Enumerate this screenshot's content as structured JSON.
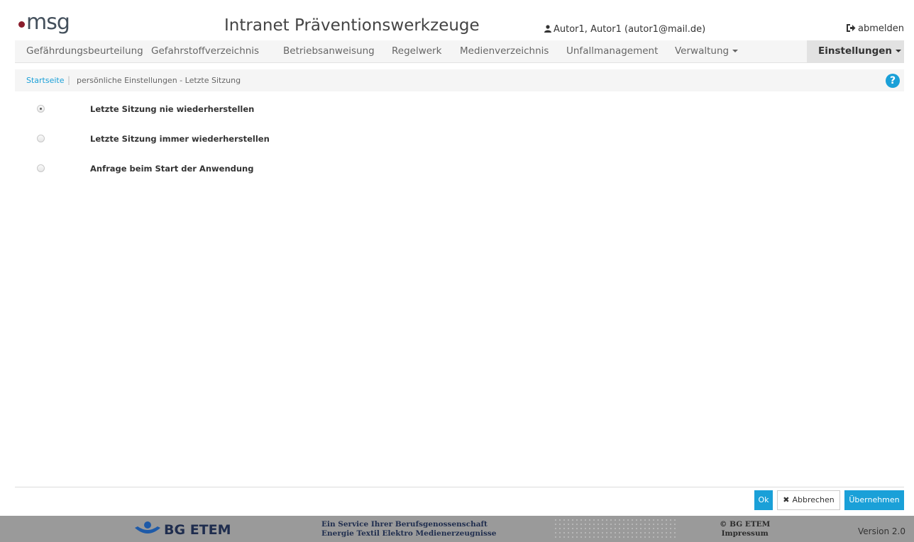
{
  "header": {
    "logo_text": "msg",
    "app_title": "Intranet Präventionswerkzeuge",
    "user": "Autor1, Autor1 (autor1@mail.de)",
    "logout_label": "abmelden"
  },
  "nav": {
    "items": [
      {
        "label": "Gefährdungsbeurteilung"
      },
      {
        "label": "Gefahrstoffverzeichnis"
      },
      {
        "label": "Betriebsanweisung"
      },
      {
        "label": "Regelwerk"
      },
      {
        "label": "Medienverzeichnis"
      },
      {
        "label": "Unfallmanagement"
      },
      {
        "label": "Verwaltung"
      }
    ],
    "active": "Einstellungen"
  },
  "breadcrumb": {
    "home": "Startseite",
    "separator": "|",
    "current": "persönliche Einstellungen - Letzte Sitzung"
  },
  "help_icon": "?",
  "options": [
    {
      "label": "Letzte Sitzung nie wiederherstellen",
      "checked": true
    },
    {
      "label": "Letzte Sitzung immer wiederherstellen",
      "checked": false
    },
    {
      "label": "Anfrage beim Start der Anwendung",
      "checked": false
    }
  ],
  "buttons": {
    "ok": "Ok",
    "cancel": "Abbrechen",
    "apply": "Übernehmen"
  },
  "footer": {
    "brand": "BG ETEM",
    "service_line1": "Ein Service Ihrer Berufsgenossenschaft",
    "service_line2": "Energie Textil Elektro Medienerzeugnisse",
    "copyright": "© BG ETEM",
    "impressum": "Impressum",
    "version": "Version 2.0"
  },
  "colors": {
    "accent": "#1aa0d8",
    "logo_dot": "#8a1d2c",
    "footer_bg": "#9a9a9a",
    "brand_navy": "#1f2d4e"
  }
}
